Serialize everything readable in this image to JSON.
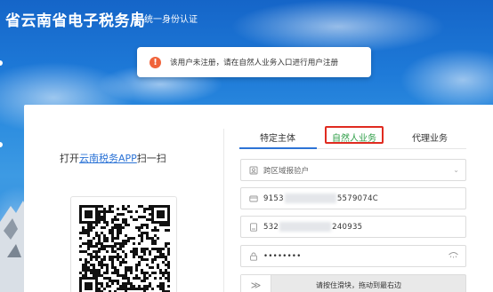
{
  "header": {
    "title": "省云南省电子税务局",
    "subtitle": "统一身份认证"
  },
  "toast": {
    "icon": "!",
    "message": "该用户未注册，请在自然人业务入口进行用户注册"
  },
  "qr": {
    "prefix": "打开",
    "app_name": "云南税务APP",
    "suffix": "扫一扫"
  },
  "tabs": [
    {
      "label": "特定主体",
      "active": true
    },
    {
      "label": "自然人业务",
      "highlighted": true
    },
    {
      "label": "代理业务"
    }
  ],
  "form": {
    "region_placeholder": "跨区域报验户",
    "tax_id_prefix": "9153",
    "tax_id_suffix": "5579074C",
    "id_prefix": "532",
    "id_suffix": "240935",
    "password_mask": "••••••••",
    "slider_text": "请按住滑块，拖动到最右边"
  },
  "colors": {
    "accent": "#2d74d6",
    "highlight_border": "#e02b20",
    "toast_icon": "#f0633a"
  },
  "icons": [
    "user-icon",
    "card-icon",
    "id-card-icon",
    "lock-icon",
    "eye-icon",
    "chevron-down-icon",
    "double-chevron-right-icon",
    "warning-icon"
  ]
}
